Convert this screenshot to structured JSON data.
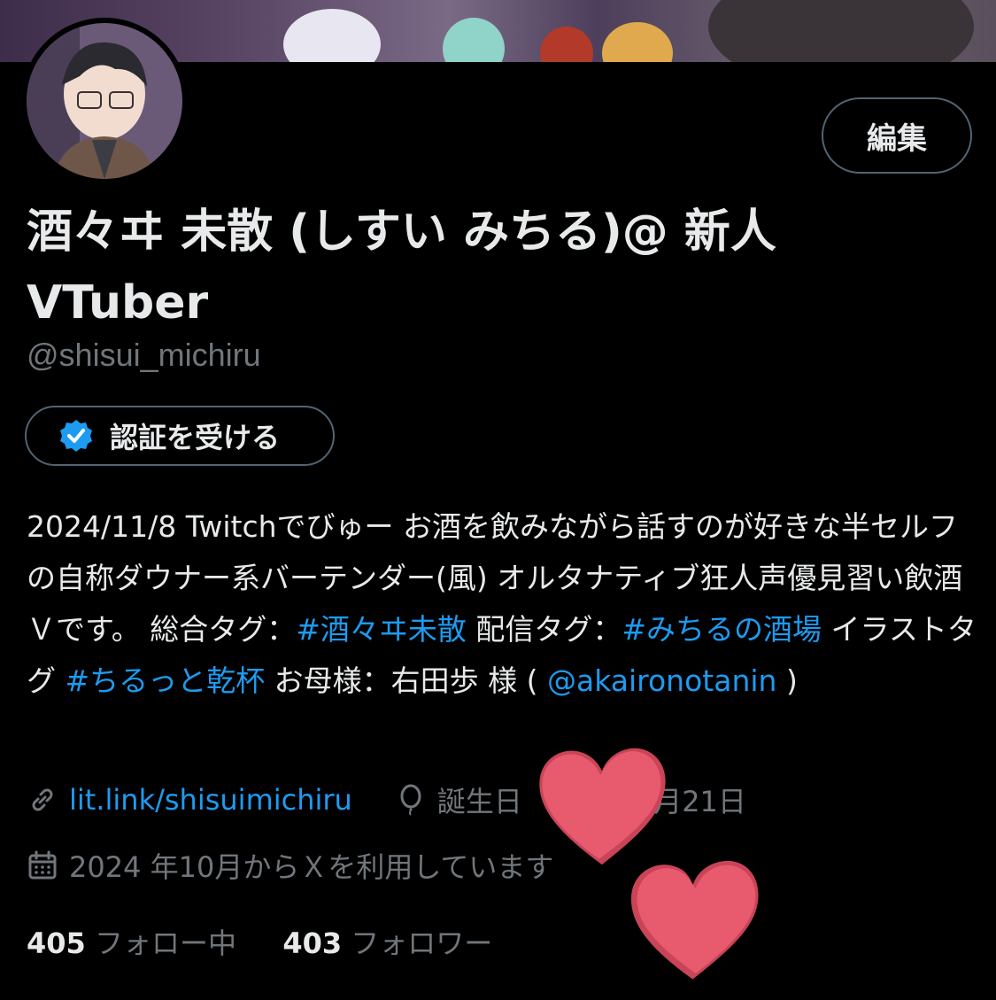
{
  "profile": {
    "display_name": "酒々ヰ 未散 (しすい みちる)@ 新人 VTuber",
    "handle": "@shisui_michiru",
    "edit_label": "編集",
    "verify_label": "認証を受ける"
  },
  "bio": {
    "part1": "2024/11/8 Twitchでびゅー お酒を飲みながら話すのが好きな半セルフの自称ダウナー系バーテンダー(風) オルタナティブ狂人声優見習い飲酒Ｖです。 総合タグ：",
    "tag1": "#酒々ヰ未散",
    "part2": " 配信タグ：",
    "tag2": "#みちるの酒場",
    "part3": " イラストタグ ",
    "tag3": "#ちるっと乾杯",
    "part4": " お母様：右田歩 様 ( ",
    "mention": "@akaironotanin",
    "part5": " )"
  },
  "meta": {
    "link": "lit.link/shisuimichiru",
    "birthday": "誕生日　　　　5月21日",
    "joined": "2024 年10月からＸを利用しています"
  },
  "stats": {
    "following_count": "405",
    "following_label": "フォロー中",
    "followers_count": "403",
    "followers_label": "フォロワー"
  },
  "colors": {
    "accent": "#1d9bf0",
    "muted": "#71767b",
    "heart": "#e85a6e"
  },
  "icons": [
    "link-icon",
    "balloon-icon",
    "calendar-icon",
    "verified-check-icon"
  ]
}
